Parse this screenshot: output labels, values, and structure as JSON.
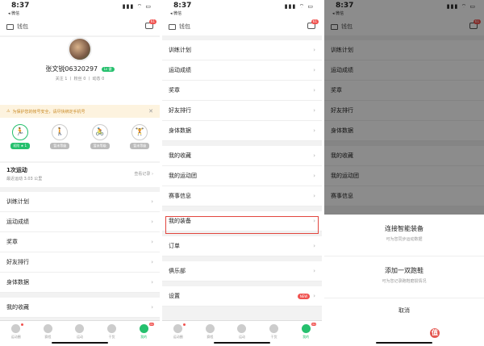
{
  "status": {
    "time": "8:37",
    "carrier": "◂ 微信",
    "icons": "▮▮▮ ⌔ ▭"
  },
  "topbar": {
    "wallet": "钱包",
    "badge": "61"
  },
  "profile": {
    "name": "张文锐06320297",
    "level": "Lv 健",
    "follow_line": "关注 1 丨 粉丝 0 丨 动态 0"
  },
  "banner": {
    "text": "为保护您的帐号安全，请尽快绑定手机号",
    "close": "✕"
  },
  "sports": [
    {
      "icon": "🏃",
      "tag": "初阶 ★ 1",
      "active": true
    },
    {
      "icon": "🚶",
      "tag": "暂未等级",
      "active": false
    },
    {
      "icon": "🚴",
      "tag": "暂未等级",
      "active": false
    },
    {
      "icon": "🏋",
      "tag": "暂未等级",
      "active": false
    }
  ],
  "run": {
    "title": "1次运动",
    "subtitle": "最近运动 3.03 公里",
    "right": "查看记录 ›"
  },
  "menu1": [
    "训练计划",
    "运动成绩",
    "奖章",
    "好友排行",
    "身体数据",
    "我的收藏"
  ],
  "menu2": {
    "group1": [
      "训练计划",
      "运动成绩",
      "奖章",
      "好友排行",
      "身体数据"
    ],
    "group2": [
      "我的收藏",
      "我的运动团",
      "赛事信息"
    ],
    "group3": [
      "我的装备"
    ],
    "group4": [
      "订单"
    ],
    "group5": [
      "俱乐部"
    ],
    "group6": [
      "设置"
    ],
    "new_tag": "NEW"
  },
  "menu3": [
    "训练计划",
    "运动成绩",
    "奖章",
    "好友排行",
    "身体数据",
    "我的收藏",
    "我的运动团",
    "赛事信息"
  ],
  "sheet": {
    "options": [
      {
        "title": "连接智能装备",
        "sub": "可为您同步运动数据"
      },
      {
        "title": "添加一双跑鞋",
        "sub": "可为您记录跑鞋磨损情况"
      }
    ],
    "cancel": "取消"
  },
  "tabs": [
    "运动圈",
    "赛程",
    "运动",
    "干货",
    "我的"
  ],
  "tab_badge": "61",
  "watermark": "什么值得买",
  "watermark_icon": "值",
  "colors": {
    "accent": "#25c06d",
    "alert": "#f0524f",
    "highlight": "#e2463f"
  }
}
